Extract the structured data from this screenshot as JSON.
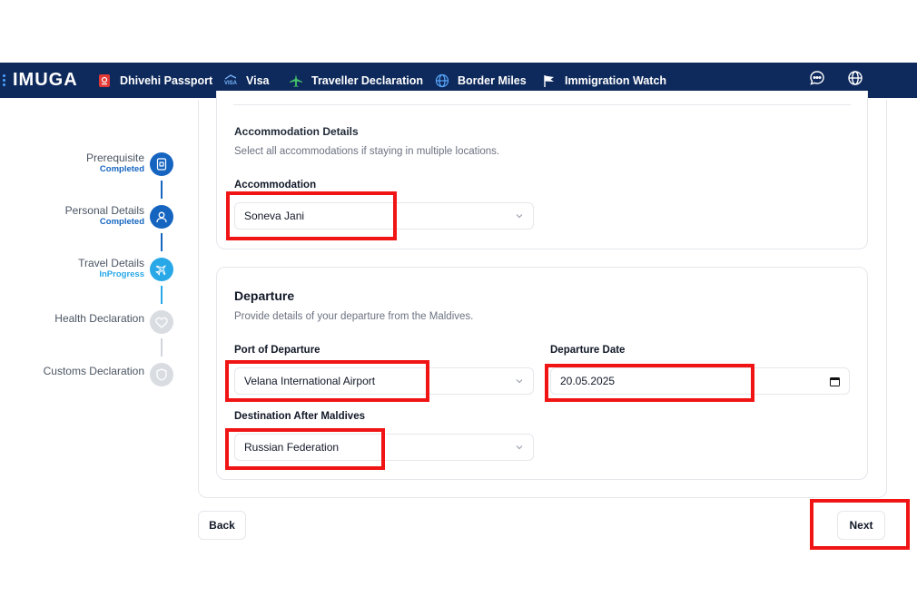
{
  "nav": {
    "brand": "IMUGA",
    "items": [
      {
        "label": "Dhivehi Passport",
        "icon": "passport-icon"
      },
      {
        "label": "Visa",
        "icon": "visa-icon"
      },
      {
        "label": "Traveller Declaration",
        "icon": "airplane-icon"
      },
      {
        "label": "Border Miles",
        "icon": "globe-icon"
      },
      {
        "label": "Immigration Watch",
        "icon": "flag-icon"
      }
    ],
    "icon_sub_visa": "VISA"
  },
  "stepper": [
    {
      "label": "Prerequisite",
      "status": "Completed"
    },
    {
      "label": "Personal Details",
      "status": "Completed"
    },
    {
      "label": "Travel Details",
      "status": "InProgress"
    },
    {
      "label": "Health Declaration",
      "status": ""
    },
    {
      "label": "Customs Declaration",
      "status": ""
    }
  ],
  "accommodation": {
    "title": "Accommodation Details",
    "description": "Select all accommodations if staying in multiple locations.",
    "field_label": "Accommodation",
    "value": "Soneva Jani"
  },
  "departure": {
    "title": "Departure",
    "description": "Provide details of your departure from the Maldives.",
    "port_label": "Port of Departure",
    "port_value": "Velana International Airport",
    "date_label": "Departure Date",
    "date_value": "20.05.2025",
    "destination_label": "Destination After Maldives",
    "destination_value": "Russian Federation"
  },
  "buttons": {
    "back": "Back",
    "next": "Next"
  },
  "colors": {
    "nav_bg": "#0e2a5c",
    "step_done": "#1565c0",
    "step_active": "#29a8e8",
    "step_pending": "#d1d5db",
    "highlight": "#f01414"
  }
}
